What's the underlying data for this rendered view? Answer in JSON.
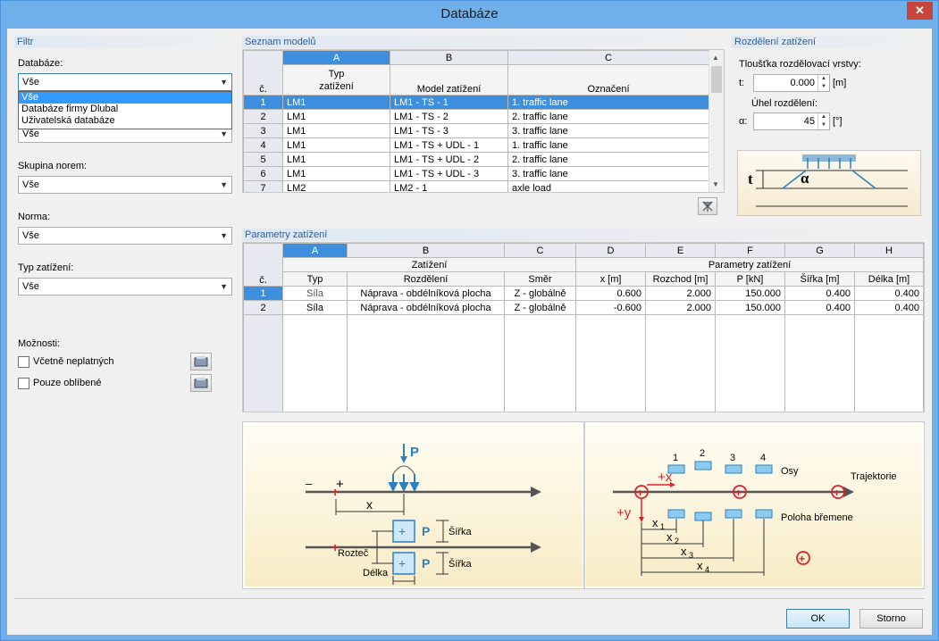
{
  "window": {
    "title": "Databáze",
    "close_glyph": "✕"
  },
  "filter": {
    "heading": "Filtr",
    "database_label": "Databáze:",
    "database_value": "Vše",
    "database_options": [
      "Vše",
      "Databáze firmy Dlubal",
      "Uživatelská databáze"
    ],
    "hidden_combo_value": "Vše",
    "norm_group_label": "Skupina norem:",
    "norm_group_value": "Vše",
    "norm_label": "Norma:",
    "norm_value": "Vše",
    "load_type_label": "Typ zatížení:",
    "load_type_value": "Vše",
    "options_label": "Možnosti:",
    "incl_invalid": "Včetně neplatných",
    "only_favorites": "Pouze oblíbené"
  },
  "models": {
    "heading": "Seznam modelů",
    "col_letters": [
      "A",
      "B",
      "C"
    ],
    "rownum_header": "č.",
    "col_headers": [
      "Typ\nzatížení",
      "Model zatížení",
      "Označení"
    ],
    "rows": [
      {
        "n": "1",
        "a": "LM1",
        "b": "LM1 - TS - 1",
        "c": "1. traffic lane"
      },
      {
        "n": "2",
        "a": "LM1",
        "b": "LM1 - TS - 2",
        "c": "2. traffic lane"
      },
      {
        "n": "3",
        "a": "LM1",
        "b": "LM1 - TS - 3",
        "c": "3. traffic lane"
      },
      {
        "n": "4",
        "a": "LM1",
        "b": "LM1 - TS + UDL - 1",
        "c": "1. traffic lane"
      },
      {
        "n": "5",
        "a": "LM1",
        "b": "LM1 - TS + UDL - 2",
        "c": "2. traffic lane"
      },
      {
        "n": "6",
        "a": "LM1",
        "b": "LM1 - TS + UDL - 3",
        "c": "3. traffic lane"
      },
      {
        "n": "7",
        "a": "LM2",
        "b": "LM2 - 1",
        "c": "axle load"
      }
    ]
  },
  "distribution": {
    "heading": "Rozdělení zatížení",
    "thickness_label": "Tloušťka rozdělovací vrstvy:",
    "t_label": "t:",
    "t_value": "0.000",
    "t_unit": "[m]",
    "angle_label": "Úhel rozdělení:",
    "alpha_label": "α:",
    "alpha_value": "45",
    "alpha_unit": "[°]",
    "img_t": "t",
    "img_alpha": "α"
  },
  "params": {
    "heading": "Parametry zatížení",
    "col_letters": [
      "A",
      "B",
      "C",
      "D",
      "E",
      "F",
      "G",
      "H"
    ],
    "rownum_header": "č.",
    "group_zat": "Zatížení",
    "group_param": "Parametry zatížení",
    "col_headers": [
      "Typ",
      "Rozdělení",
      "Směr",
      "x [m]",
      "Rozchod [m]",
      "P [kN]",
      "Šířka [m]",
      "Délka [m]"
    ],
    "rows": [
      {
        "n": "1",
        "typ": "Síla",
        "rozd": "Náprava - obdélníková plocha",
        "smer": "Z - globálně",
        "x": "0.600",
        "rozchod": "2.000",
        "p": "150.000",
        "sirka": "0.400",
        "delka": "0.400"
      },
      {
        "n": "2",
        "typ": "Síla",
        "rozd": "Náprava - obdélníková plocha",
        "smer": "Z - globálně",
        "x": "-0.600",
        "rozchod": "2.000",
        "p": "150.000",
        "sirka": "0.400",
        "delka": "0.400"
      }
    ]
  },
  "diagram_left": {
    "p": "P",
    "minus": "–",
    "plus": "+",
    "x": "x",
    "sirka": "Šířka",
    "roztec": "Rozteč",
    "delka": "Délka"
  },
  "diagram_right": {
    "n1": "1",
    "n2": "2",
    "n3": "3",
    "n4": "4",
    "osy": "Osy",
    "trajektorie": "Trajektorie",
    "plus_x": "+x",
    "plus_y": "+y",
    "poloha": "Poloha břemene",
    "x1": "x",
    "x2": "x",
    "x3": "x",
    "x4": "x",
    "s1": "1",
    "s2": "2",
    "s3": "3",
    "s4": "4"
  },
  "buttons": {
    "ok": "OK",
    "cancel": "Storno"
  },
  "colors": {
    "accent": "#3d8fdd",
    "title_bar": "#6fb0ea",
    "close": "#c7453a",
    "diagram_red": "#e0202a",
    "diagram_blue": "#3a9ad9"
  }
}
